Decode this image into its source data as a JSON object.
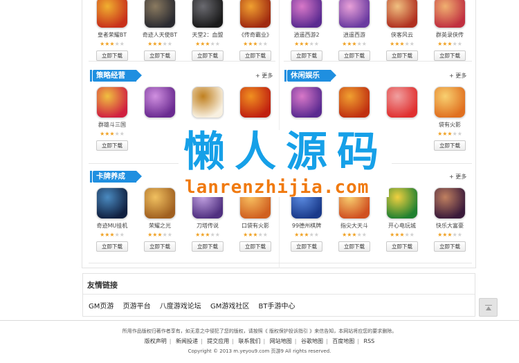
{
  "row1": [
    {
      "name": "皇者荣耀BT",
      "rating": 3,
      "download": "立即下载",
      "c1": "#c8301a",
      "c2": "#f0b030"
    },
    {
      "name": "奇迹人天使BT",
      "rating": 3,
      "download": "立即下载",
      "c1": "#2a2a30",
      "c2": "#8a7a60"
    },
    {
      "name": "天堂2：血盟",
      "rating": 3,
      "download": "立即下载",
      "c1": "#1a1a1a",
      "c2": "#6a6a70"
    },
    {
      "name": "《传奇霸业》",
      "rating": 3,
      "download": "立即下载",
      "c1": "#a02a10",
      "c2": "#f0a030"
    },
    {
      "name": "逍遥西游2",
      "rating": 3,
      "download": "立即下载",
      "c1": "#5a2a90",
      "c2": "#d878c8"
    },
    {
      "name": "逍遥西游",
      "rating": 3,
      "download": "立即下载",
      "c1": "#6a3aa0",
      "c2": "#e8a0d8"
    },
    {
      "name": "侠客风云",
      "rating": 3,
      "download": "立即下载",
      "c1": "#b03020",
      "c2": "#f0c080"
    },
    {
      "name": "群英录侠传",
      "rating": 3,
      "download": "立即下载",
      "c1": "#c03040",
      "c2": "#f0b070"
    }
  ],
  "section_strategy": {
    "title": "策略经营",
    "more": "+ 更多"
  },
  "section_casual": {
    "title": "休闲娱乐",
    "more": "+ 更多"
  },
  "section_card": {
    "title": "卡牌养成",
    "more": "+ 更多"
  },
  "row2": [
    {
      "name": "群雄斗三国",
      "rating": 3,
      "download": "立即下载",
      "c1": "#d02040",
      "c2": "#f0c040"
    },
    {
      "name": "",
      "rating": 0,
      "download": "",
      "c1": "#6a2a90",
      "c2": "#d090e0"
    },
    {
      "name": "",
      "rating": 0,
      "download": "",
      "c1": "#f8f0e0",
      "c2": "#c08020"
    },
    {
      "name": "",
      "rating": 0,
      "download": "",
      "c1": "#c02010",
      "c2": "#f09020"
    },
    {
      "name": "",
      "rating": 0,
      "download": "",
      "c1": "#5a2a90",
      "c2": "#d878c8"
    },
    {
      "name": "",
      "rating": 0,
      "download": "",
      "c1": "#c03010",
      "c2": "#f0a030"
    },
    {
      "name": "",
      "rating": 0,
      "download": "",
      "c1": "#e03030",
      "c2": "#f0a0a0"
    },
    {
      "name": "袋有火影",
      "rating": 3,
      "download": "立即下载",
      "c1": "#e07020",
      "c2": "#f8d070"
    }
  ],
  "row3": [
    {
      "name": "奇迹MU挂机",
      "rating": 3,
      "download": "立即下载",
      "c1": "#102040",
      "c2": "#4a8ac0"
    },
    {
      "name": "荣耀之光",
      "rating": 3,
      "download": "立即下载",
      "c1": "#a06020",
      "c2": "#f0c060"
    },
    {
      "name": "刀塔传说",
      "rating": 3,
      "download": "立即下载",
      "c1": "#503080",
      "c2": "#c0a0e0"
    },
    {
      "name": "口袋有火影",
      "rating": 3,
      "download": "立即下载",
      "c1": "#d06020",
      "c2": "#f8c060"
    },
    {
      "name": "99德州棋牌",
      "rating": 3,
      "download": "立即下载",
      "c1": "#1a3a8a",
      "c2": "#5a8ae0"
    },
    {
      "name": "指尖大天斗",
      "rating": 3,
      "download": "立即下载",
      "c1": "#d05020",
      "c2": "#f8d070"
    },
    {
      "name": "开心电玩城",
      "rating": 3,
      "download": "立即下载",
      "c1": "#208030",
      "c2": "#f0d040"
    },
    {
      "name": "快乐大富豪",
      "rating": 3,
      "download": "立即下载",
      "c1": "#3a1a3a",
      "c2": "#c08060"
    }
  ],
  "friends": {
    "title": "友情链接",
    "links": [
      "GM页游",
      "页游平台",
      "八度游戏论坛",
      "GM游戏社区",
      "BT手游中心"
    ]
  },
  "footer": {
    "notice": "所用作品版权归著作者享有，如无意之中侵犯了您的版权，请按照《 版权保护投诉指引 》来信告知，本网站将应您的要求删除。",
    "links": [
      "版权声明",
      "新闻投递",
      "提交应用",
      "联系我们",
      "网站地图",
      "谷歌地图",
      "百度地图",
      "RSS"
    ],
    "copyright": "Copyright © 2013  m.yeyou9.com  页游9  All rights reserved."
  },
  "watermark": {
    "cn": "懒人源码",
    "en": "lanrenzhijia.com"
  }
}
